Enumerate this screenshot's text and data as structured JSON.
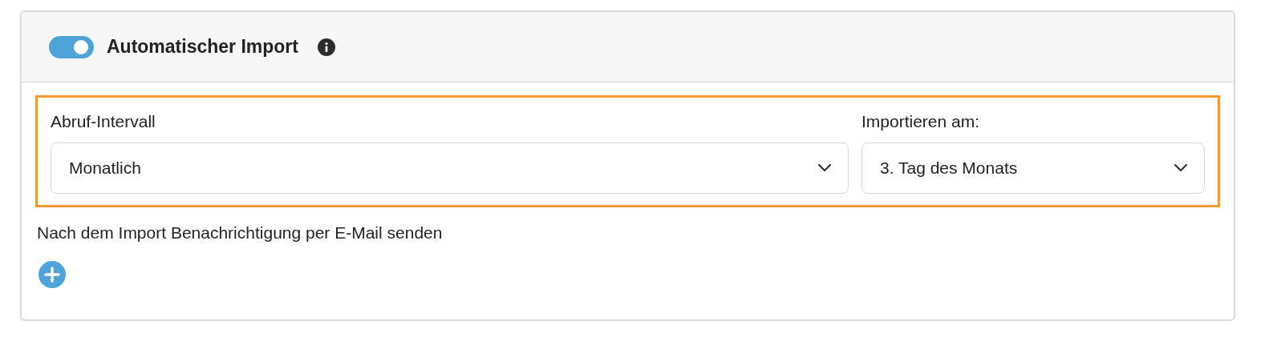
{
  "header": {
    "toggle": {
      "on": true
    },
    "title": "Automatischer Import"
  },
  "schedule": {
    "highlighted": true,
    "fields": [
      {
        "label": "Abruf-Intervall",
        "value": "Monatlich"
      },
      {
        "label": "Importieren am:",
        "value": "3. Tag des Monats"
      }
    ]
  },
  "notification": {
    "label": "Nach dem Import Benachrichtigung per E-Mail senden"
  }
}
